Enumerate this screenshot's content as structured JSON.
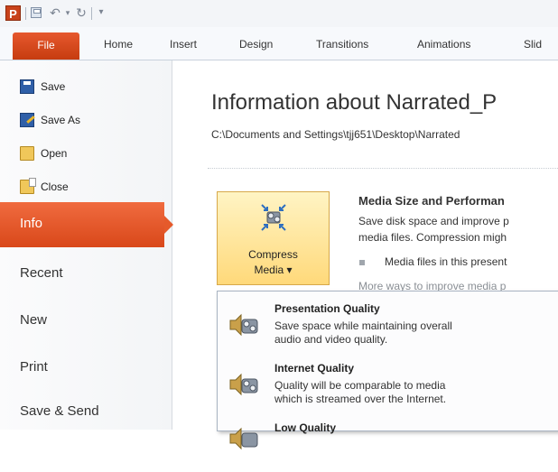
{
  "qat": {
    "app_logo_letter": "P",
    "icons": [
      "save-icon",
      "undo-icon",
      "redo-icon",
      "customize-icon"
    ]
  },
  "ribbon": {
    "file_tab": "File",
    "tabs": [
      "Home",
      "Insert",
      "Design",
      "Transitions",
      "Animations",
      "Slid"
    ]
  },
  "nav": {
    "small_items": [
      "Save",
      "Save As",
      "Open",
      "Close"
    ],
    "info": "Info",
    "big_items": [
      "Recent",
      "New",
      "Print",
      "Save & Send"
    ]
  },
  "main": {
    "title": "Information about Narrated_P",
    "path": "C:\\Documents and Settings\\tjj651\\Desktop\\Narrated",
    "compress": {
      "line1": "Compress",
      "line2": "Media ▾"
    },
    "media_heading": "Media Size and Performan",
    "media_lines": [
      "Save disk space and improve p",
      "media files. Compression migh"
    ],
    "bullet_text": "Media files in this present",
    "more_link": "More ways to improve media p"
  },
  "dropdown": {
    "items": [
      {
        "title": "Presentation Quality",
        "desc1": "Save space while maintaining overall",
        "desc2": "audio and video quality."
      },
      {
        "title": "Internet Quality",
        "desc1": "Quality will be comparable to media",
        "desc2": "which is streamed over the Internet."
      },
      {
        "title": "Low Quality"
      }
    ]
  },
  "colors": {
    "accent": "#d9481a",
    "compress_button": "#ffd97a"
  }
}
